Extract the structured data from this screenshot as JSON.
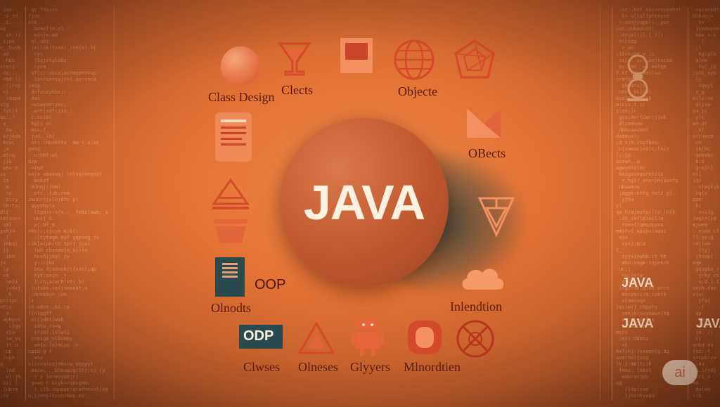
{
  "hero": {
    "title": "JAVA"
  },
  "labels": {
    "class_design": "Class Design",
    "clects": "Clects",
    "objecte": "Objecte",
    "objects": "OBects",
    "oop": "OOP",
    "olnodts": "Olnodts",
    "inlendtion": "Inlendtion",
    "odp": "ODP",
    "clwses": "Clwses",
    "olneses": "Olneses",
    "glyyers": "Glyyers",
    "mlnordtien": "Mlnordtien"
  },
  "side": {
    "java_1": "JAVA",
    "java_2": "JAVA",
    "java_3": "JAVA"
  },
  "badge": {
    "text": "ai"
  },
  "colors": {
    "accent": "#e36a3d",
    "icon_red": "#d54a2a",
    "dark_teal": "#2a4a50",
    "cream": "#fbf1de"
  }
}
